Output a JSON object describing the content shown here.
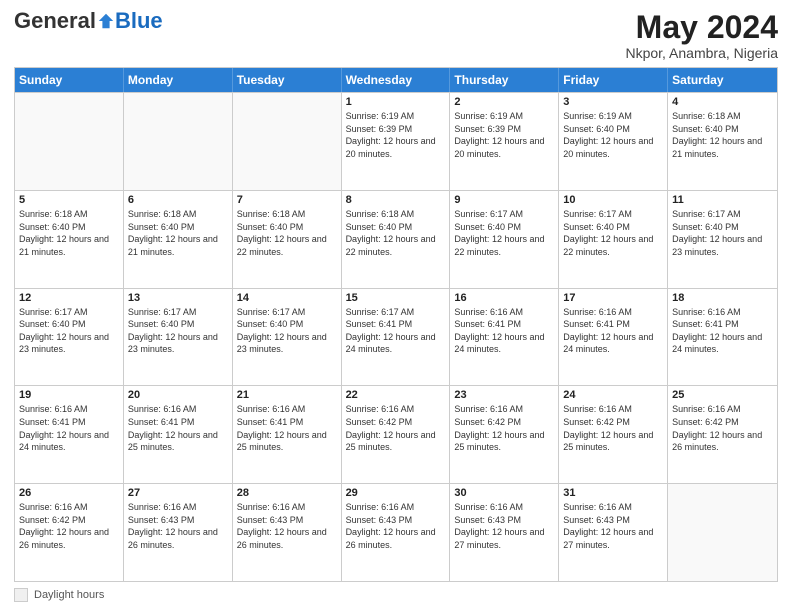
{
  "header": {
    "logo_general": "General",
    "logo_blue": "Blue",
    "month_title": "May 2024",
    "location": "Nkpor, Anambra, Nigeria"
  },
  "days_of_week": [
    "Sunday",
    "Monday",
    "Tuesday",
    "Wednesday",
    "Thursday",
    "Friday",
    "Saturday"
  ],
  "weeks": [
    [
      {
        "day": "",
        "info": "",
        "empty": true
      },
      {
        "day": "",
        "info": "",
        "empty": true
      },
      {
        "day": "",
        "info": "",
        "empty": true
      },
      {
        "day": "1",
        "info": "Sunrise: 6:19 AM\nSunset: 6:39 PM\nDaylight: 12 hours and 20 minutes.",
        "empty": false
      },
      {
        "day": "2",
        "info": "Sunrise: 6:19 AM\nSunset: 6:39 PM\nDaylight: 12 hours and 20 minutes.",
        "empty": false
      },
      {
        "day": "3",
        "info": "Sunrise: 6:19 AM\nSunset: 6:40 PM\nDaylight: 12 hours and 20 minutes.",
        "empty": false
      },
      {
        "day": "4",
        "info": "Sunrise: 6:18 AM\nSunset: 6:40 PM\nDaylight: 12 hours and 21 minutes.",
        "empty": false
      }
    ],
    [
      {
        "day": "5",
        "info": "Sunrise: 6:18 AM\nSunset: 6:40 PM\nDaylight: 12 hours and 21 minutes.",
        "empty": false
      },
      {
        "day": "6",
        "info": "Sunrise: 6:18 AM\nSunset: 6:40 PM\nDaylight: 12 hours and 21 minutes.",
        "empty": false
      },
      {
        "day": "7",
        "info": "Sunrise: 6:18 AM\nSunset: 6:40 PM\nDaylight: 12 hours and 22 minutes.",
        "empty": false
      },
      {
        "day": "8",
        "info": "Sunrise: 6:18 AM\nSunset: 6:40 PM\nDaylight: 12 hours and 22 minutes.",
        "empty": false
      },
      {
        "day": "9",
        "info": "Sunrise: 6:17 AM\nSunset: 6:40 PM\nDaylight: 12 hours and 22 minutes.",
        "empty": false
      },
      {
        "day": "10",
        "info": "Sunrise: 6:17 AM\nSunset: 6:40 PM\nDaylight: 12 hours and 22 minutes.",
        "empty": false
      },
      {
        "day": "11",
        "info": "Sunrise: 6:17 AM\nSunset: 6:40 PM\nDaylight: 12 hours and 23 minutes.",
        "empty": false
      }
    ],
    [
      {
        "day": "12",
        "info": "Sunrise: 6:17 AM\nSunset: 6:40 PM\nDaylight: 12 hours and 23 minutes.",
        "empty": false
      },
      {
        "day": "13",
        "info": "Sunrise: 6:17 AM\nSunset: 6:40 PM\nDaylight: 12 hours and 23 minutes.",
        "empty": false
      },
      {
        "day": "14",
        "info": "Sunrise: 6:17 AM\nSunset: 6:40 PM\nDaylight: 12 hours and 23 minutes.",
        "empty": false
      },
      {
        "day": "15",
        "info": "Sunrise: 6:17 AM\nSunset: 6:41 PM\nDaylight: 12 hours and 24 minutes.",
        "empty": false
      },
      {
        "day": "16",
        "info": "Sunrise: 6:16 AM\nSunset: 6:41 PM\nDaylight: 12 hours and 24 minutes.",
        "empty": false
      },
      {
        "day": "17",
        "info": "Sunrise: 6:16 AM\nSunset: 6:41 PM\nDaylight: 12 hours and 24 minutes.",
        "empty": false
      },
      {
        "day": "18",
        "info": "Sunrise: 6:16 AM\nSunset: 6:41 PM\nDaylight: 12 hours and 24 minutes.",
        "empty": false
      }
    ],
    [
      {
        "day": "19",
        "info": "Sunrise: 6:16 AM\nSunset: 6:41 PM\nDaylight: 12 hours and 24 minutes.",
        "empty": false
      },
      {
        "day": "20",
        "info": "Sunrise: 6:16 AM\nSunset: 6:41 PM\nDaylight: 12 hours and 25 minutes.",
        "empty": false
      },
      {
        "day": "21",
        "info": "Sunrise: 6:16 AM\nSunset: 6:41 PM\nDaylight: 12 hours and 25 minutes.",
        "empty": false
      },
      {
        "day": "22",
        "info": "Sunrise: 6:16 AM\nSunset: 6:42 PM\nDaylight: 12 hours and 25 minutes.",
        "empty": false
      },
      {
        "day": "23",
        "info": "Sunrise: 6:16 AM\nSunset: 6:42 PM\nDaylight: 12 hours and 25 minutes.",
        "empty": false
      },
      {
        "day": "24",
        "info": "Sunrise: 6:16 AM\nSunset: 6:42 PM\nDaylight: 12 hours and 25 minutes.",
        "empty": false
      },
      {
        "day": "25",
        "info": "Sunrise: 6:16 AM\nSunset: 6:42 PM\nDaylight: 12 hours and 26 minutes.",
        "empty": false
      }
    ],
    [
      {
        "day": "26",
        "info": "Sunrise: 6:16 AM\nSunset: 6:42 PM\nDaylight: 12 hours and 26 minutes.",
        "empty": false
      },
      {
        "day": "27",
        "info": "Sunrise: 6:16 AM\nSunset: 6:43 PM\nDaylight: 12 hours and 26 minutes.",
        "empty": false
      },
      {
        "day": "28",
        "info": "Sunrise: 6:16 AM\nSunset: 6:43 PM\nDaylight: 12 hours and 26 minutes.",
        "empty": false
      },
      {
        "day": "29",
        "info": "Sunrise: 6:16 AM\nSunset: 6:43 PM\nDaylight: 12 hours and 26 minutes.",
        "empty": false
      },
      {
        "day": "30",
        "info": "Sunrise: 6:16 AM\nSunset: 6:43 PM\nDaylight: 12 hours and 27 minutes.",
        "empty": false
      },
      {
        "day": "31",
        "info": "Sunrise: 6:16 AM\nSunset: 6:43 PM\nDaylight: 12 hours and 27 minutes.",
        "empty": false
      },
      {
        "day": "",
        "info": "",
        "empty": true
      }
    ]
  ],
  "footer": {
    "daylight_label": "Daylight hours"
  }
}
